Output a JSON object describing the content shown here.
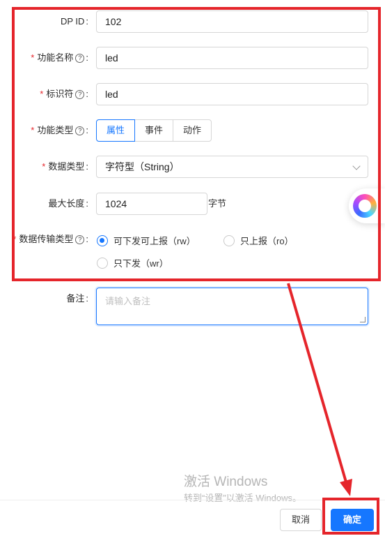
{
  "form": {
    "dp_id": {
      "label": "DP ID",
      "value": "102"
    },
    "function_name": {
      "required": "*",
      "label": "功能名称",
      "help": "?",
      "value": "led"
    },
    "identifier": {
      "required": "*",
      "label": "标识符",
      "help": "?",
      "value": "led"
    },
    "function_type": {
      "required": "*",
      "label": "功能类型",
      "help": "?",
      "options": [
        "属性",
        "事件",
        "动作"
      ],
      "selected": "属性"
    },
    "data_type": {
      "required": "*",
      "label": "数据类型",
      "value": "字符型（String）"
    },
    "max_length": {
      "label": "最大长度",
      "value": "1024",
      "unit": "字节"
    },
    "transfer_type": {
      "required": "*",
      "label": "数据传输类型",
      "help": "?",
      "options": [
        {
          "label": "可下发可上报（rw）",
          "checked": true
        },
        {
          "label": "只上报（ro）",
          "checked": false
        },
        {
          "label": "只下发（wr）",
          "checked": false
        }
      ]
    },
    "remark": {
      "label": "备注",
      "placeholder": "请输入备注"
    }
  },
  "footer": {
    "cancel_label": "取消",
    "ok_label": "确定"
  },
  "watermark": {
    "line1": "激活 Windows",
    "line2": "转到“设置”以激活 Windows。"
  },
  "colors": {
    "primary": "#1677ff",
    "annotation_red": "#e5252b",
    "required_star": "#e5252b"
  }
}
